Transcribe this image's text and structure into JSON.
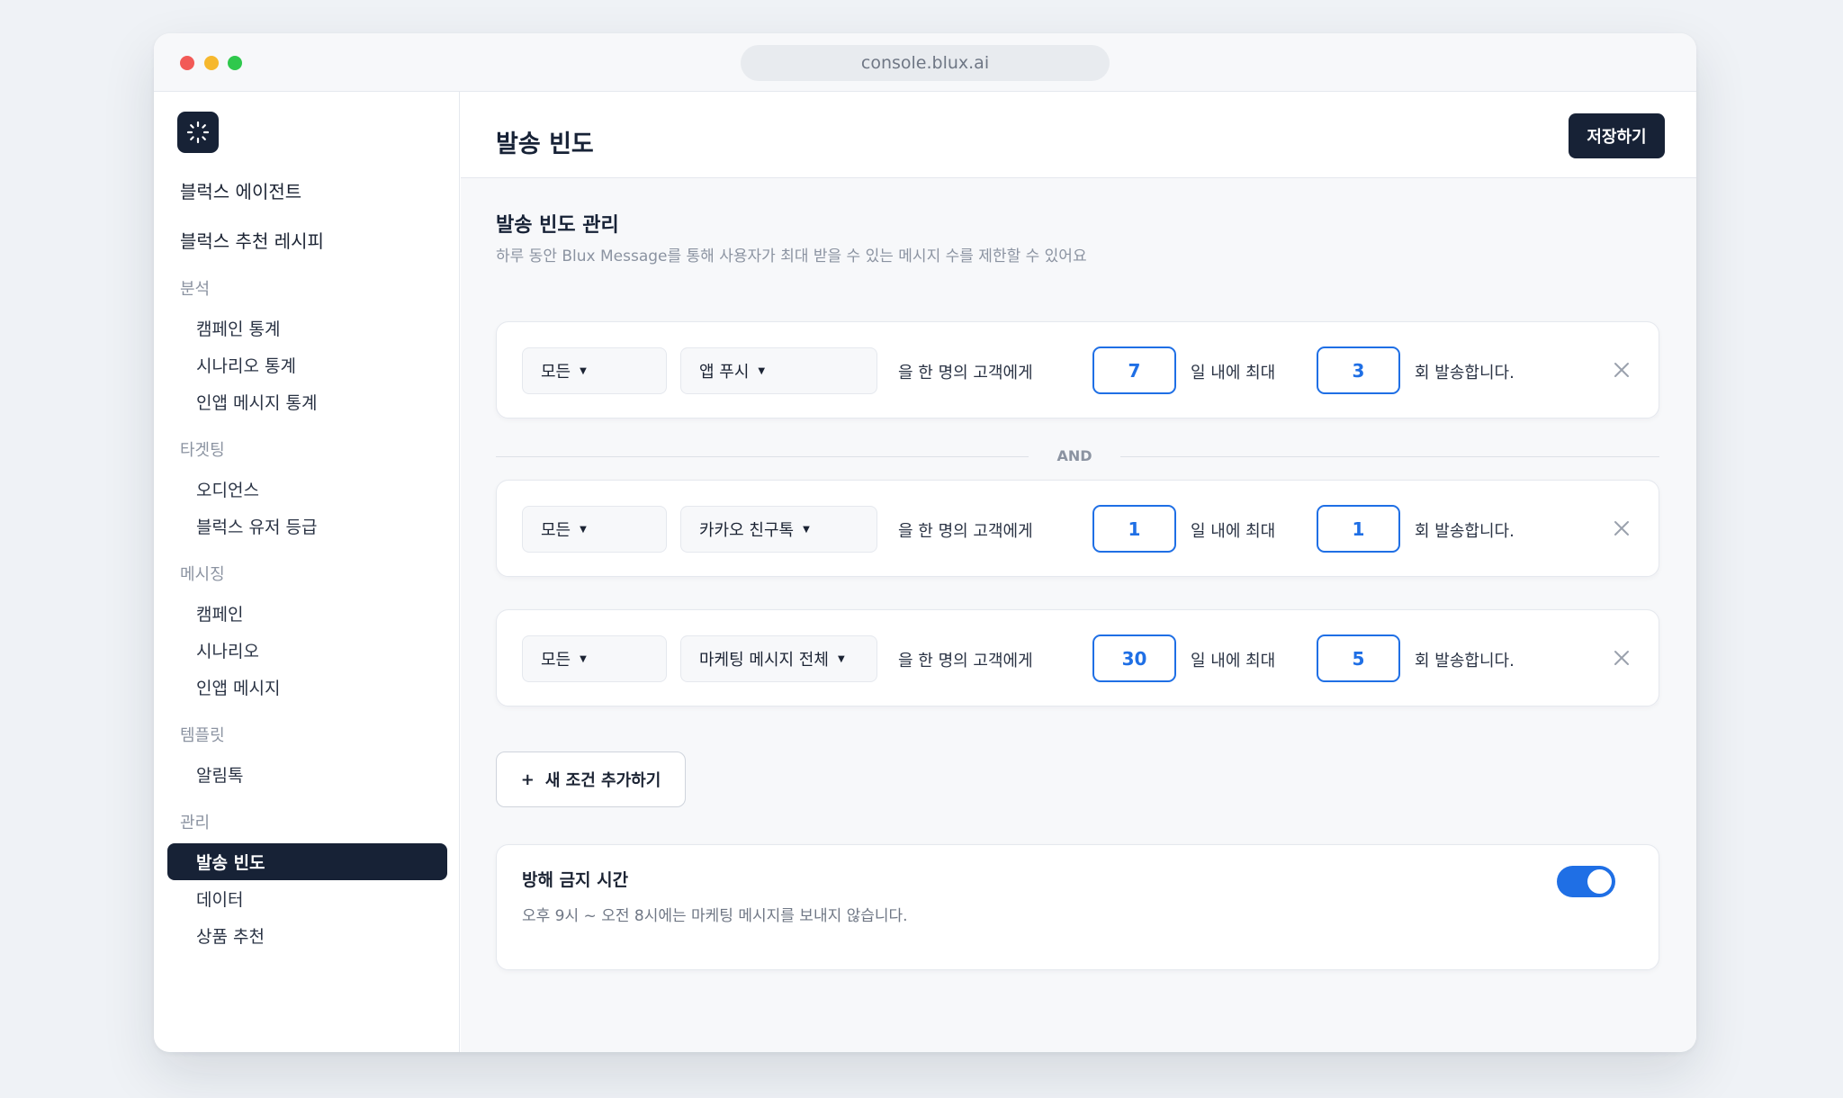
{
  "browser": {
    "url": "console.blux.ai"
  },
  "sidebar": {
    "top_items": [
      "블럭스 에이전트",
      "블럭스 추천 레시피"
    ],
    "sections": [
      {
        "label": "분석",
        "items": [
          "캠페인 통계",
          "시나리오 통계",
          "인앱 메시지 통계"
        ]
      },
      {
        "label": "타겟팅",
        "items": [
          "오디언스",
          "블럭스 유저 등급"
        ]
      },
      {
        "label": "메시징",
        "items": [
          "캠페인",
          "시나리오",
          "인앱 메시지"
        ]
      },
      {
        "label": "템플릿",
        "items": [
          "알림톡"
        ]
      },
      {
        "label": "관리",
        "items": [
          "발송 빈도",
          "데이터",
          "상품 추천"
        ]
      }
    ],
    "active_item": "발송 빈도"
  },
  "header": {
    "title": "발송 빈도",
    "save_label": "저장하기"
  },
  "section": {
    "title": "발송 빈도 관리",
    "description": "하루 동안 Blux Message를 통해 사용자가 최대 받을 수 있는 메시지 수를 제한할 수 있어요"
  },
  "rules": [
    {
      "scope": "모든",
      "channel": "앱 푸시",
      "text_target": "을 한 명의 고객에게",
      "days": "7",
      "text_within": "일 내에 최대",
      "count": "3",
      "text_send": "회 발송합니다."
    },
    {
      "scope": "모든",
      "channel": "카카오 친구톡",
      "text_target": "을 한 명의 고객에게",
      "days": "1",
      "text_within": "일 내에 최대",
      "count": "1",
      "text_send": "회 발송합니다."
    },
    {
      "scope": "모든",
      "channel": "마케팅 메시지 전체",
      "text_target": "을 한 명의 고객에게",
      "days": "30",
      "text_within": "일 내에 최대",
      "count": "5",
      "text_send": "회 발송합니다."
    }
  ],
  "and_label": "AND",
  "add_condition": {
    "plus": "+",
    "label": "새 조건 추가하기"
  },
  "do_not_disturb": {
    "title": "방해 금지 시간",
    "description": "오후 9시 ~ 오전 8시에는 마케팅 메시지를 보내지 않습니다.",
    "enabled": true
  },
  "colors": {
    "primary": "#1f6fe5",
    "navy": "#172236",
    "background": "#f7f8fa"
  }
}
